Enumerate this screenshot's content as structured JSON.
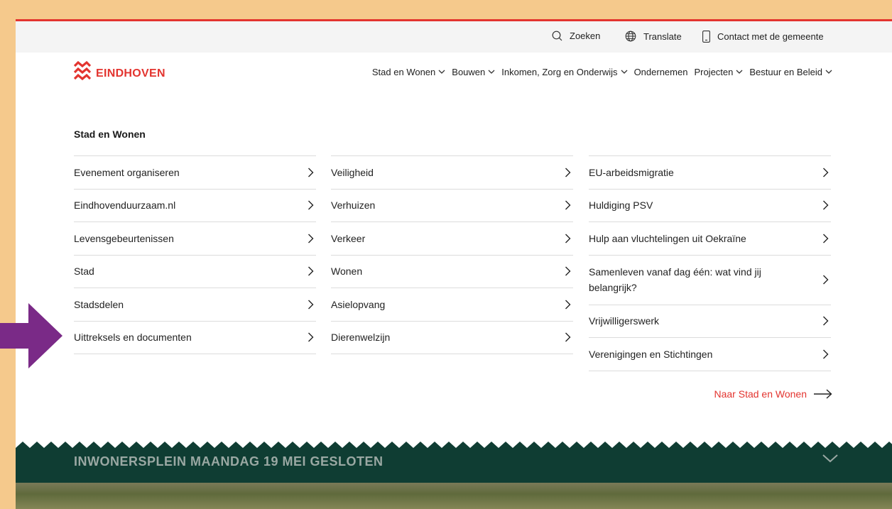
{
  "utility": {
    "search_label": "Zoeken",
    "translate_label": "Translate",
    "contact_label": "Contact met de gemeente"
  },
  "logo": {
    "text": "EINDHOVEN"
  },
  "nav": [
    {
      "label": "Stad en Wonen"
    },
    {
      "label": "Bouwen"
    },
    {
      "label": "Inkomen, Zorg en Onderwijs"
    },
    {
      "label": "Ondernemen"
    },
    {
      "label": "Projecten"
    },
    {
      "label": "Bestuur en Beleid"
    }
  ],
  "menu": {
    "title": "Stad en Wonen",
    "col1": [
      "Evenement organiseren",
      "Eindhovenduurzaam.nl",
      "Levensgebeurtenissen",
      "Stad",
      "Stadsdelen",
      "Uittreksels en documenten"
    ],
    "col2": [
      "Veiligheid",
      "Verhuizen",
      "Verkeer",
      "Wonen",
      "Asielopvang",
      "Dierenwelzijn"
    ],
    "col3": [
      "EU-arbeidsmigratie",
      "Huldiging PSV",
      "Hulp aan vluchtelingen uit Oekraïne",
      "Samenleven vanaf dag één: wat vind jij belangrijk?",
      "Vrijwilligerswerk",
      "Verenigingen en Stichtingen"
    ],
    "more_link": "Naar Stad en Wonen"
  },
  "banner": {
    "text": "INWONERSPLEIN MAANDAG 19 MEI GESLOTEN"
  },
  "colors": {
    "brand_red": "#e3342f",
    "banner_green": "#0f3d33",
    "annotation_arrow": "#7a2a87",
    "page_border": "#f5c98c"
  }
}
